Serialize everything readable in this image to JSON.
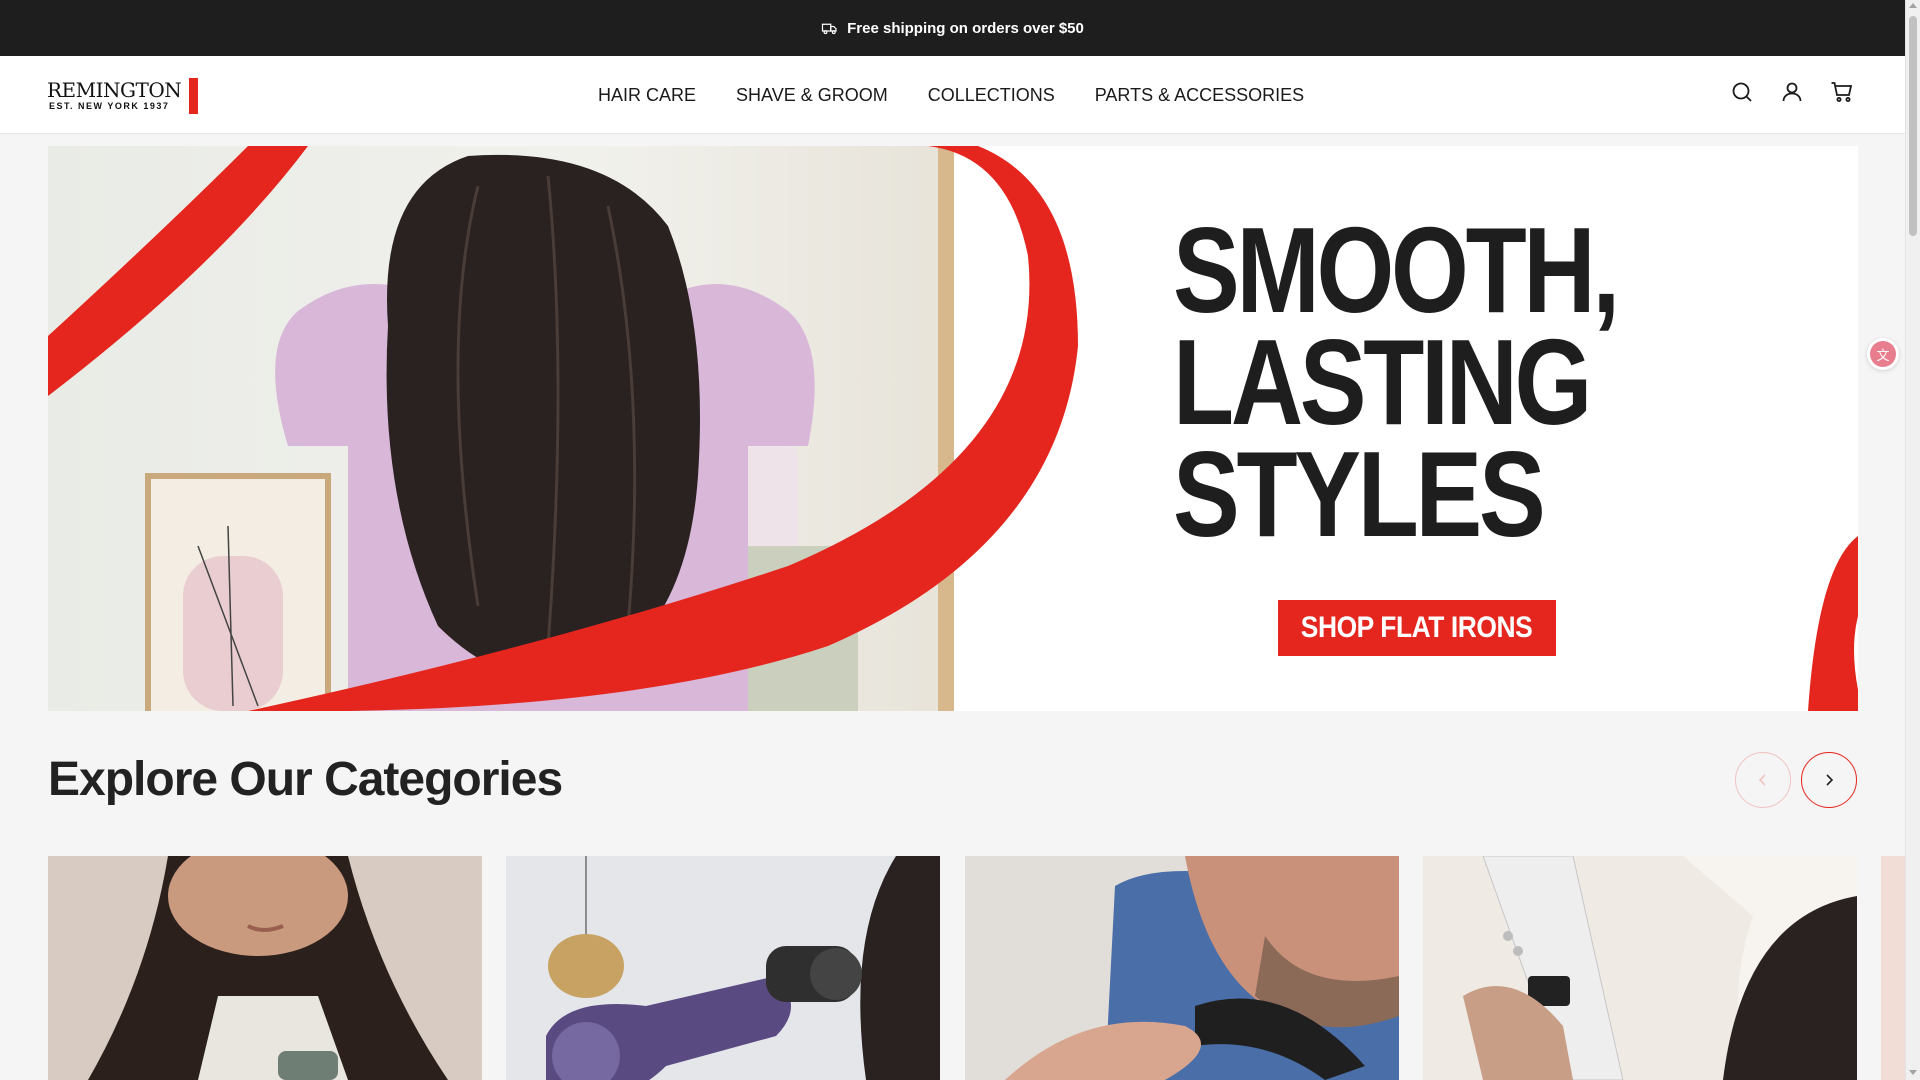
{
  "announcement": {
    "icon": "truck-icon",
    "text": "Free shipping on orders over $50"
  },
  "header": {
    "logo": {
      "wordmark": "REMINGTON",
      "tagline": "EST. NEW YORK 1937"
    },
    "nav": [
      {
        "label": "HAIR CARE"
      },
      {
        "label": "SHAVE & GROOM"
      },
      {
        "label": "COLLECTIONS"
      },
      {
        "label": "PARTS & ACCESSORIES"
      }
    ],
    "icons": [
      "search-icon",
      "account-icon",
      "cart-icon"
    ]
  },
  "hero": {
    "headline_line1": "SMOOTH,",
    "headline_line2": "LASTING",
    "headline_line3": "STYLES",
    "cta_label": "SHOP FLAT IRONS"
  },
  "categories": {
    "title": "Explore Our Categories",
    "prev_icon": "chevron-left-icon",
    "next_icon": "chevron-right-icon"
  },
  "colors": {
    "brand_red": "#e5261e",
    "announcement_bg": "#1e1e1e",
    "page_bg": "#f5f5f5"
  }
}
